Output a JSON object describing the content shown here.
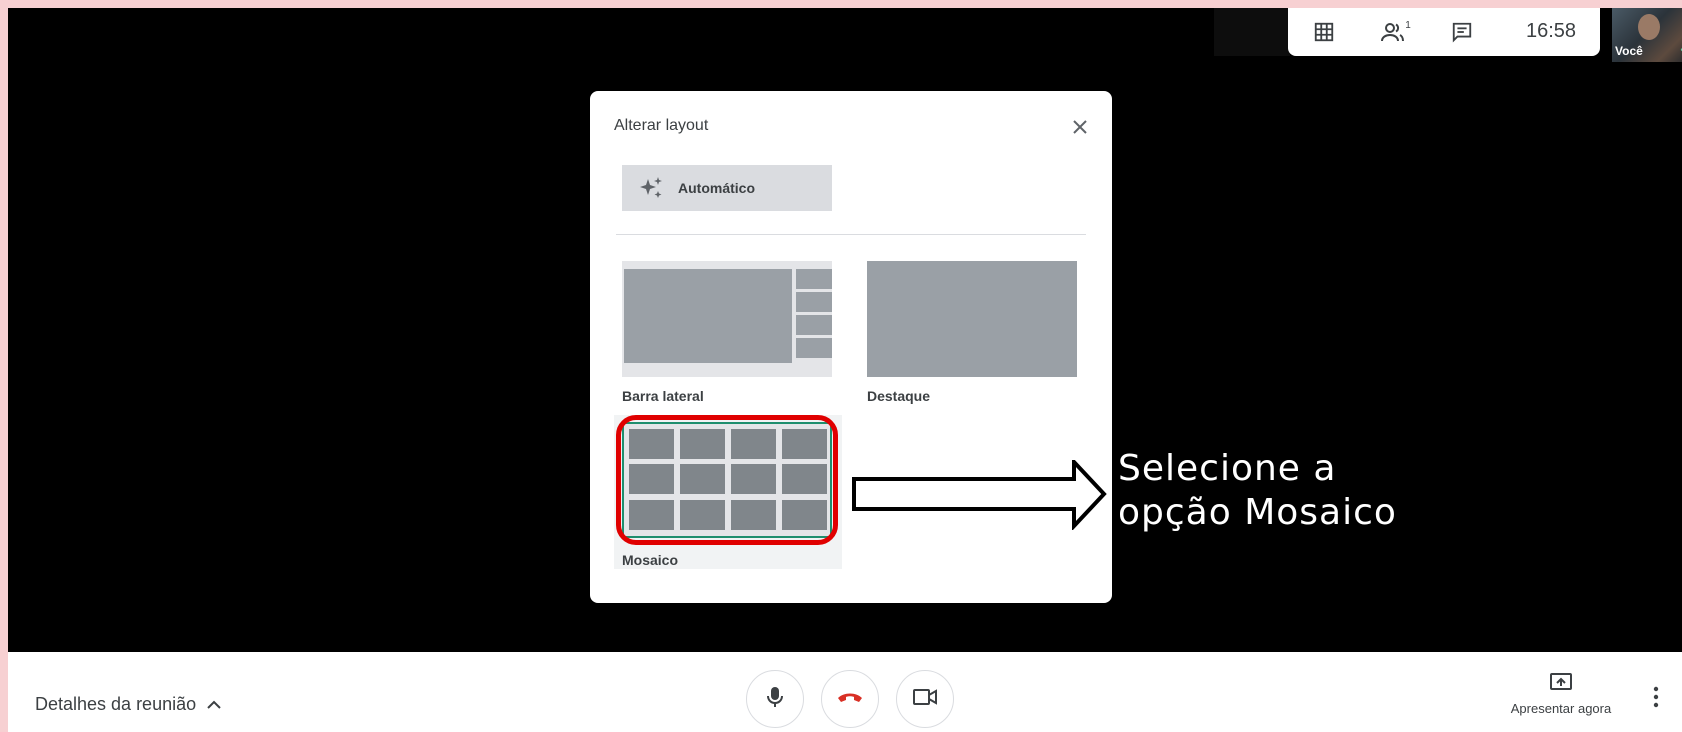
{
  "top_bar": {
    "clock": "16:58",
    "participants_count": "1",
    "self_name": "Você",
    "icons": [
      "grid-icon",
      "people-icon",
      "chat-icon"
    ]
  },
  "dialog": {
    "title": "Alterar layout",
    "auto_label": "Automático",
    "options": [
      {
        "label": "Barra lateral"
      },
      {
        "label": "Destaque"
      },
      {
        "label": "Mosaico"
      }
    ],
    "selected": "Mosaico"
  },
  "annotation": {
    "line1": "Selecione a",
    "line2": "opção Mosaico"
  },
  "bottom_bar": {
    "details_label": "Detalhes da reunião",
    "present_label": "Apresentar agora"
  },
  "colors": {
    "page_border": "#f7d0d2",
    "stage": "#000000",
    "highlight": "#e00000",
    "selected_border": "#1e8e6e",
    "hangup": "#d93025"
  }
}
